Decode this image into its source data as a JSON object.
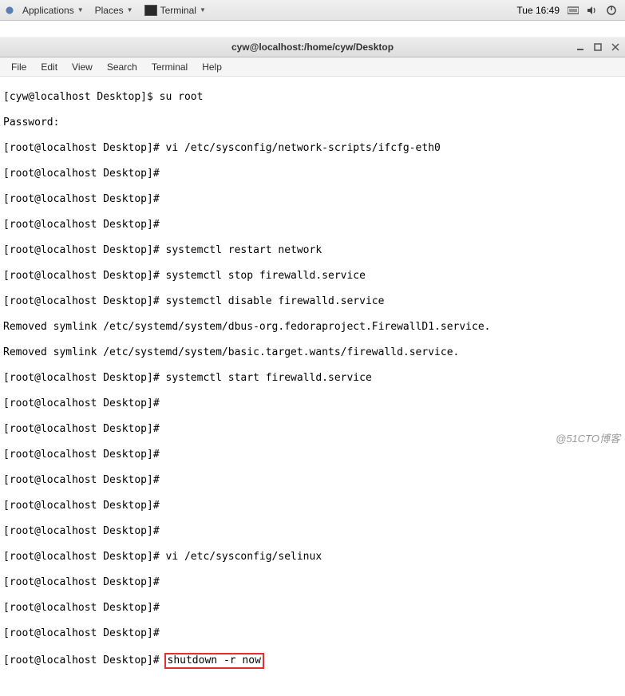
{
  "panel": {
    "applications": "Applications",
    "places": "Places",
    "terminal": "Terminal",
    "clock": "Tue 16:49"
  },
  "window": {
    "title": "cyw@localhost:/home/cyw/Desktop"
  },
  "menu": {
    "file": "File",
    "edit": "Edit",
    "view": "View",
    "search": "Search",
    "terminal": "Terminal",
    "help": "Help"
  },
  "lines": {
    "l0": "[cyw@localhost Desktop]$ su root",
    "l1": "Password:",
    "l2": "[root@localhost Desktop]# vi /etc/sysconfig/network-scripts/ifcfg-eth0",
    "l3": "[root@localhost Desktop]#",
    "l4": "[root@localhost Desktop]#",
    "l5": "[root@localhost Desktop]#",
    "l6": "[root@localhost Desktop]# systemctl restart network",
    "l7": "[root@localhost Desktop]# systemctl stop firewalld.service",
    "l8": "[root@localhost Desktop]# systemctl disable firewalld.service",
    "l9": "Removed symlink /etc/systemd/system/dbus-org.fedoraproject.FirewallD1.service.",
    "l10": "Removed symlink /etc/systemd/system/basic.target.wants/firewalld.service.",
    "l11": "[root@localhost Desktop]# systemctl start firewalld.service",
    "l12": "[root@localhost Desktop]#",
    "l13": "[root@localhost Desktop]#",
    "l14": "[root@localhost Desktop]#",
    "l15": "[root@localhost Desktop]#",
    "l16": "[root@localhost Desktop]#",
    "l17": "[root@localhost Desktop]#",
    "l18": "[root@localhost Desktop]# vi /etc/sysconfig/selinux",
    "l19": "[root@localhost Desktop]#",
    "l20": "[root@localhost Desktop]#",
    "l21": "[root@localhost Desktop]#",
    "l22_prompt": "[root@localhost Desktop]# ",
    "l22_cmd": "shutdown -r now"
  },
  "watermark": "@51CTO博客"
}
